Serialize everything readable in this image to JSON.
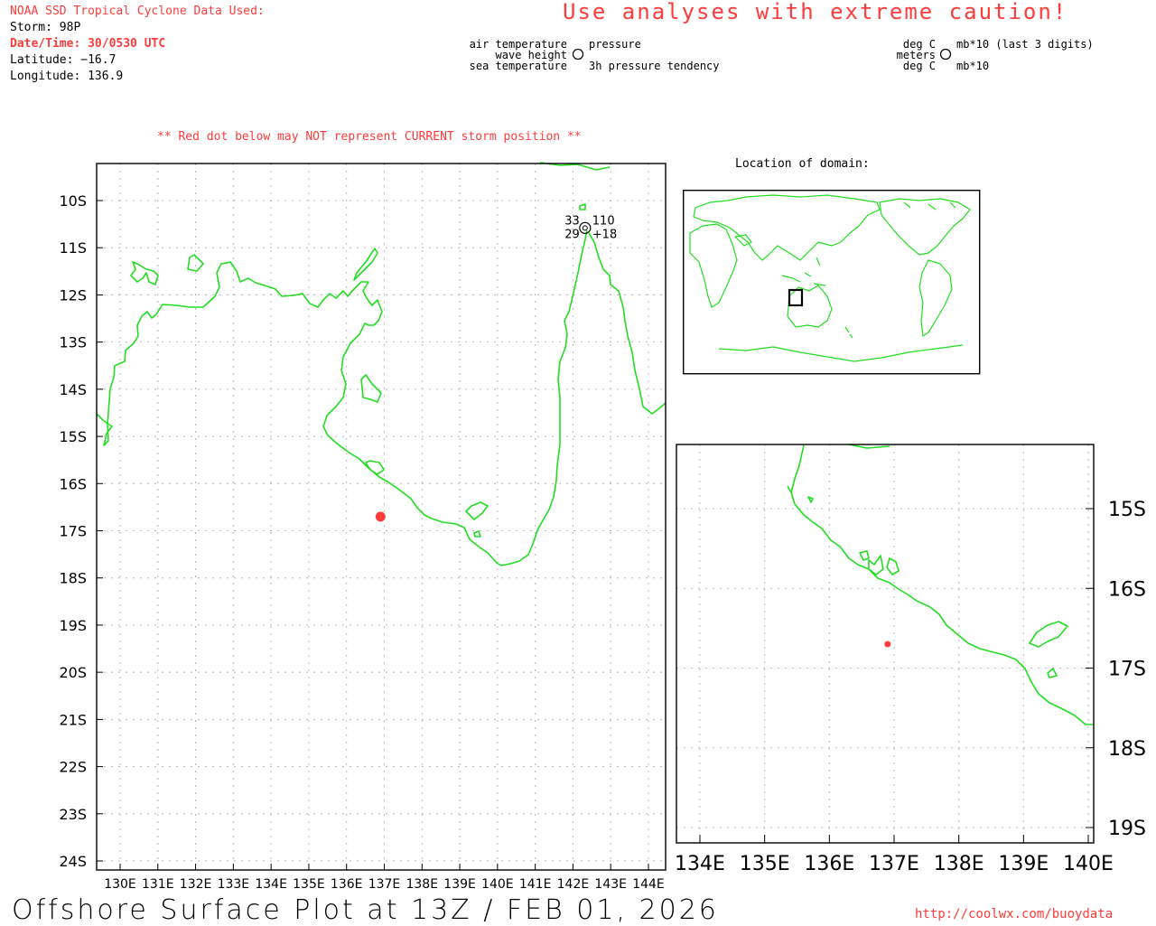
{
  "header": {
    "source": "NOAA SSD Tropical Cyclone Data Used:",
    "storm": "Storm: 98P",
    "datetime": "Date/Time: 30/0530 UTC",
    "latitude": "Latitude: −16.7",
    "longitude": "Longitude: 136.9",
    "caution": "Use analyses with extreme caution!",
    "red_dot_note": "** Red dot below may NOT represent CURRENT storm position **"
  },
  "legend": {
    "air_temperature": "air temperature",
    "wave_height": "wave height",
    "sea_temperature": "sea temperature",
    "pressure": "pressure",
    "pressure_tendency": "3h pressure tendency",
    "unit_air": "deg C",
    "unit_wave": "meters",
    "unit_sea": "deg C",
    "unit_pressure": "mb*10 (last 3 digits)",
    "unit_tendency": "mb*10"
  },
  "inset_title": "Location of domain:",
  "footer": {
    "title": "Offshore Surface Plot at 13Z / FEB 01, 2026",
    "url": "http://coolwx.com/buoydata"
  },
  "main_map": {
    "lat_labels": [
      "10S",
      "11S",
      "12S",
      "13S",
      "14S",
      "15S",
      "16S",
      "17S",
      "18S",
      "19S",
      "20S",
      "21S",
      "22S",
      "23S",
      "24S"
    ],
    "lon_labels": [
      "130E",
      "131E",
      "132E",
      "133E",
      "134E",
      "135E",
      "136E",
      "137E",
      "138E",
      "139E",
      "140E",
      "141E",
      "142E",
      "143E",
      "144E"
    ],
    "station": {
      "air_temp": "33",
      "pressure": "110",
      "sea_temp": "29",
      "tendency": "+18",
      "lat": -10.6,
      "lon": 142.2
    },
    "storm_position": {
      "lat": -16.7,
      "lon": 136.9
    }
  },
  "zoom_map": {
    "lat_labels": [
      "15S",
      "16S",
      "17S",
      "18S",
      "19S"
    ],
    "lon_labels": [
      "134E",
      "135E",
      "136E",
      "137E",
      "138E",
      "139E",
      "140E"
    ]
  },
  "colors": {
    "coastline": "#22dd22",
    "storm_dot": "#ff3b3b",
    "header_red": "#ff3b3b"
  }
}
